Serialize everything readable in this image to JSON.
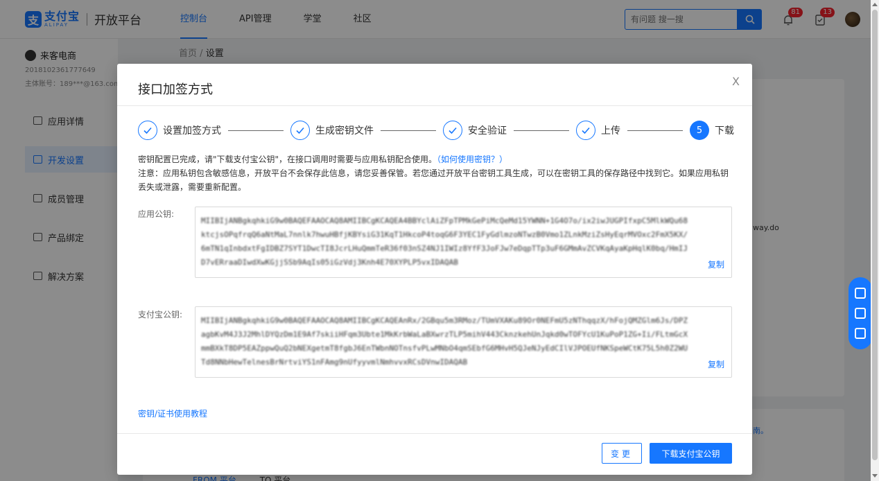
{
  "brand": {
    "logo_char": "支",
    "name_zh": "支付宝",
    "name_en": "ALIPAY",
    "platform": "开放平台"
  },
  "nav": {
    "items": [
      "控制台",
      "API管理",
      "学堂",
      "社区"
    ],
    "active_index": 0
  },
  "search": {
    "placeholder": "有问题 搜一搜"
  },
  "notifications": {
    "bell_count": "81",
    "task_count": "13"
  },
  "sidebar": {
    "app_name": "来客电商",
    "app_id": "2018102361777649",
    "account": "主体账号：189***@163.com",
    "items": [
      {
        "label": "应用详情"
      },
      {
        "label": "开发设置"
      },
      {
        "label": "成员管理"
      },
      {
        "label": "产品绑定"
      },
      {
        "label": "解决方案"
      }
    ],
    "active_index": 1
  },
  "breadcrumb": {
    "home": "首页",
    "sep": "/",
    "current": "设置"
  },
  "background": {
    "gateway_text": "way.do",
    "guide_text": "南。",
    "tabs": [
      "FROM 平台",
      "TO 平台"
    ]
  },
  "modal": {
    "title": "接口加签方式",
    "close": "X",
    "steps": [
      {
        "label": "设置加签方式",
        "done": true
      },
      {
        "label": "生成密钥文件",
        "done": true
      },
      {
        "label": "安全验证",
        "done": true
      },
      {
        "label": "上传",
        "done": true
      },
      {
        "label": "下载",
        "number": "5",
        "current": true
      }
    ],
    "notice_line1": "密钥配置已完成，请\"下载支付宝公钥\"，在接口调用时需要与应用私钥配合使用。",
    "notice_link": "（如何使用密钥？）",
    "notice_line2": "注意：应用私钥包含敏感信息，开放平台不会保存此信息，请您妥善保管。若您通过开放平台密钥工具生成，可以在密钥工具的保存路径中找到它。如果应用私钥丢失或泄露，需要重新配置。",
    "app_public_key_label": "应用公钥:",
    "app_public_key": "MIIBIjANBgkqhkiG9w0BAQEFAAOCAQ8AMIIBCgKCAQEA4BBYclAiZFpTPMkGePiMcQeMd15YWNN+1G4O7o/ix2iwJUGPIfxpC5MlkWQu68ktcjsOPqfrqQ6aNtMaL7nnlk7hwuHBfjKBYsiG31KqT1HkcoP4toqG6F3YEC1FyGdlmzoNTwzB0Vmo1ZLnkMziZsHyEqrMVOxc2FmX5KX/6mTN1qInbdxtFgIDBZ7SYT1DwcTI8JcrLHuQmmTeR36f03nSZ4NJ1IWIz8YfF3JoFJw7eDqpTTp3uF6GMmAvZCVKqAyaKpHqlK0bq/HmIJD7vERraaDIwdXwKGjjSSb9AqIs05iGzVdj3Knh4E70XYPLP5vxIDAQAB",
    "alipay_public_key_label": "支付宝公钥:",
    "alipay_public_key": "MIIBIjANBgkqhkiG9w0BAQEFAAOCAQ8AMIIBCgKCAQEAnRx/2GBqu5m3RMoz/TUmVXAKu89Or0NEFmU5zNThqqzX/hFojQMZGlm6Js/DPZagbKvM4J3J2MhlDYQzDm1E9Af7skiiHFqm3Ubte1MkKrbWaLaBXwrzTLP5mihV443CknzkehUnJqkd0wTOFYcU1KuPoP1ZG+Ii/FLtmGcXmmBXkT8DP5EAZppwQuQ2bNEXgetmT8fgbJ6EnTWbnNOTnsfvPLwMNbO4qmSEbfG6MHvH5QJeNJyEdCIlVJPOEUfNKSpeWCtK75L5h0Z2WUTd8NNbHewTelnesBrNrtviYS1nFAmg9nUfyyvmlNmhvvxRCsDVnwIDAQAB",
    "copy_label": "复制",
    "tutorial_link": "密钥/证书使用教程",
    "change_button": "变更",
    "download_button": "下载支付宝公钥"
  },
  "colors": {
    "primary": "#1677ff",
    "badge": "#f5222d",
    "mask": "rgba(0,0,0,0.45)"
  },
  "icons": {
    "search": "search-icon",
    "bell": "bell-icon",
    "task": "task-icon",
    "check": "check-icon",
    "help": "help-icon",
    "chat": "chat-icon",
    "feedback": "feedback-icon"
  }
}
